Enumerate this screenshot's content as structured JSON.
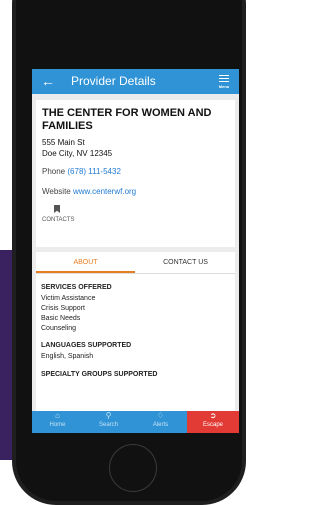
{
  "app": {
    "title": "Provider Details",
    "menu_label": "Menu"
  },
  "provider": {
    "name": "THE CENTER FOR WOMEN AND FAMILIES",
    "street": "555 Main St",
    "city": "Doe City, NV 12345",
    "phone_label": "Phone",
    "phone": "(678) 111-5432",
    "website_label": "Website",
    "website": "www.centerwf.org",
    "contacts_label": "CONTACTS"
  },
  "tabs": {
    "about": "ABOUT",
    "contact": "CONTACT US"
  },
  "about": {
    "services_title": "SERVICES OFFERED",
    "services": [
      "Victim Assistance",
      "Crisis Support",
      "Basic Needs",
      "Counseling"
    ],
    "languages_title": "LANGUAGES SUPPORTED",
    "languages": "English, Spanish",
    "specialty_title": "SPECIALTY GROUPS SUPPORTED"
  },
  "bottom_nav": {
    "home": "Home",
    "search": "Search",
    "alerts": "Alerts",
    "escape": "Escape"
  },
  "colors": {
    "primary": "#2f93d6",
    "accent": "#e67e22",
    "escape": "#e23b35",
    "link": "#1f7ad1",
    "backdrop": "#3a2160"
  }
}
